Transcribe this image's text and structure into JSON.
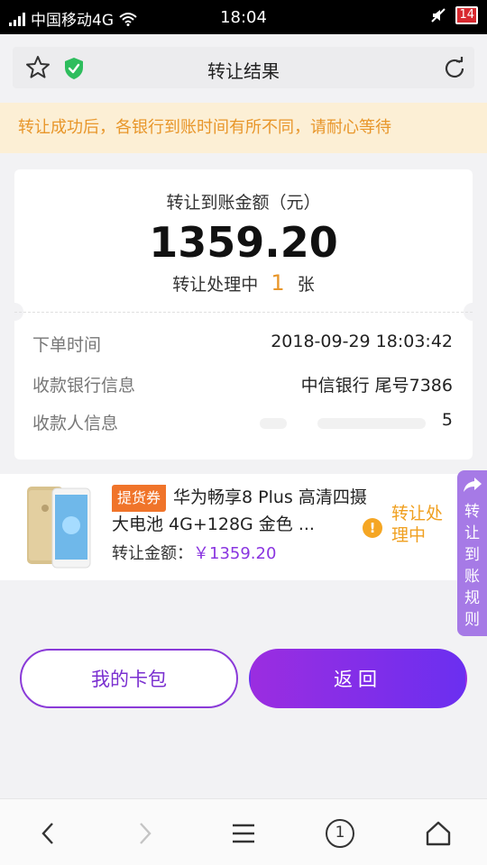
{
  "status_bar": {
    "carrier": "中国移动4G",
    "time": "18:04",
    "battery": "14"
  },
  "address_bar": {
    "title": "转让结果"
  },
  "notice": "转让成功后，各银行到账时间有所不同，请耐心等待",
  "summary": {
    "amount_label": "转让到账金额（元）",
    "amount": "1359.20",
    "processing_prefix": "转让处理中",
    "processing_count": "1",
    "processing_unit": "张"
  },
  "details": {
    "order_time_label": "下单时间",
    "order_time": "2018-09-29 18:03:42",
    "bank_label": "收款银行信息",
    "bank_value": "中信银行 尾号7386",
    "payee_label": "收款人信息",
    "payee_tail": "5"
  },
  "product": {
    "tag": "提货券",
    "name": "华为畅享8 Plus 高清四摄大电池 4G+128G 金色 ...",
    "price_label": "转让金额：",
    "price": "￥1359.20",
    "status": "转让处理中"
  },
  "side_tab": {
    "label": "转让到账规则"
  },
  "buttons": {
    "wallet": "我的卡包",
    "back": "返回"
  },
  "bottom_nav": {
    "tab_count": "1"
  },
  "colors": {
    "accent_purple": "#8a35e0",
    "notice_bg": "#fcefd5",
    "notice_text": "#e8962a",
    "status_orange": "#f0a020"
  }
}
